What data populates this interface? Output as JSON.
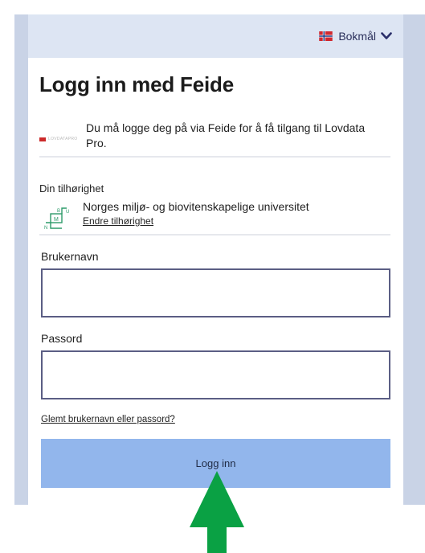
{
  "header": {
    "language_label": "Bokmål",
    "language_icon": "norway-flag-icon",
    "dropdown_icon": "chevron-down-icon"
  },
  "page": {
    "title": "Logg inn med Feide"
  },
  "intro": {
    "service_logo_text": "LOVDATAPRO",
    "message": "Du må logge deg på via Feide for å få tilgang til Lovdata Pro."
  },
  "affiliation": {
    "label": "Din tilhørighet",
    "org_icon": "nmbu-logo-icon",
    "org_name": "Norges miljø- og biovitenskapelige universitet",
    "change_link": "Endre tilhørighet"
  },
  "form": {
    "username_label": "Brukernavn",
    "username_value": "",
    "password_label": "Passord",
    "password_value": "",
    "forgot_link": "Glemt brukernavn eller passord?",
    "submit_label": "Logg inn"
  },
  "annotation": {
    "arrow_icon": "green-up-arrow-icon",
    "arrow_color": "#0aa144"
  },
  "colors": {
    "backdrop": "#c9d3e6",
    "topbar": "#dde5f3",
    "button": "#92b6ec",
    "input_border": "#5b5e84"
  }
}
